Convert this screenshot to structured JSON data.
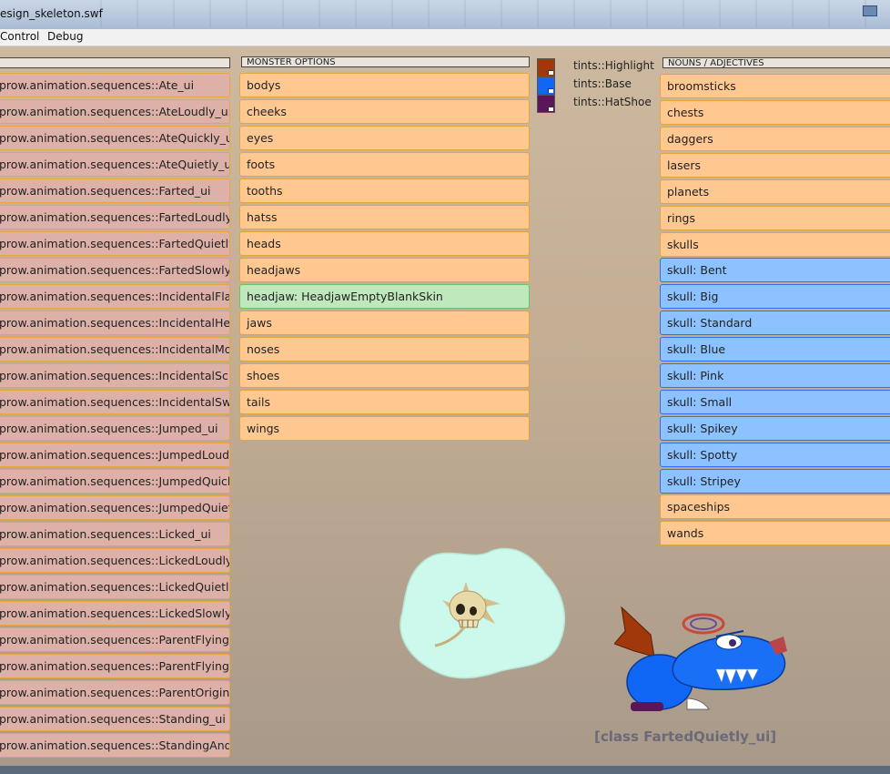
{
  "window": {
    "title": "esign_skeleton.swf"
  },
  "menu": [
    "Control",
    "Debug"
  ],
  "left_panel": {
    "header": "",
    "items": [
      "prow.animation.sequences::Ate_ui",
      "prow.animation.sequences::AteLoudly_ui",
      "prow.animation.sequences::AteQuickly_ui",
      "prow.animation.sequences::AteQuietly_ui",
      "prow.animation.sequences::Farted_ui",
      "prow.animation.sequences::FartedLoudly_u",
      "prow.animation.sequences::FartedQuietly",
      "prow.animation.sequences::FartedSlowly_u",
      "prow.animation.sequences::IncidentalFlap",
      "prow.animation.sequences::IncidentalHead",
      "prow.animation.sequences::IncidentalMout",
      "prow.animation.sequences::IncidentalScrat",
      "prow.animation.sequences::IncidentalSway",
      "prow.animation.sequences::Jumped_ui",
      "prow.animation.sequences::JumpedLoudly",
      "prow.animation.sequences::JumpedQuickly",
      "prow.animation.sequences::JumpedQuietly",
      "prow.animation.sequences::Licked_ui",
      "prow.animation.sequences::LickedLoudly_u",
      "prow.animation.sequences::LickedQuietly",
      "prow.animation.sequences::LickedSlowly_u",
      "prow.animation.sequences::ParentFlyingLo",
      "prow.animation.sequences::ParentFlyingOp",
      "prow.animation.sequences::ParentOriginal",
      "prow.animation.sequences::Standing_ui",
      "prow.animation.sequences::StandingAndFl"
    ]
  },
  "monster_options": {
    "header": "MONSTER OPTIONS",
    "items": [
      "bodys",
      "cheeks",
      "eyes",
      "foots",
      "tooths",
      "hatss",
      "heads",
      "headjaws",
      "headjaw: HeadjawEmptyBlankSkin",
      "jaws",
      "noses",
      "shoes",
      "tails",
      "wings"
    ],
    "selected": "headjaw: HeadjawEmptyBlankSkin"
  },
  "tints": [
    {
      "label": "tints::Highlight",
      "color": "#a0380a"
    },
    {
      "label": "tints::Base",
      "color": "#1167f5"
    },
    {
      "label": "tints::HatShoe",
      "color": "#5a1658"
    }
  ],
  "nouns": {
    "header": "NOUNS / ADJECTIVES",
    "items": [
      {
        "label": "broomsticks",
        "style": "orange"
      },
      {
        "label": "chests",
        "style": "orange"
      },
      {
        "label": "daggers",
        "style": "orange"
      },
      {
        "label": "lasers",
        "style": "orange"
      },
      {
        "label": "planets",
        "style": "orange"
      },
      {
        "label": "rings",
        "style": "orange"
      },
      {
        "label": "skulls",
        "style": "orange"
      },
      {
        "label": "skull: Bent",
        "style": "blue"
      },
      {
        "label": "skull: Big",
        "style": "blue"
      },
      {
        "label": "skull: Standard",
        "style": "blue"
      },
      {
        "label": "skull: Blue",
        "style": "blue"
      },
      {
        "label": "skull: Pink",
        "style": "blue"
      },
      {
        "label": "skull: Small",
        "style": "blue"
      },
      {
        "label": "skull: Spikey",
        "style": "blue"
      },
      {
        "label": "skull: Spotty",
        "style": "blue"
      },
      {
        "label": "skull: Stripey",
        "style": "blue"
      },
      {
        "label": "spaceships",
        "style": "orange"
      },
      {
        "label": "wands",
        "style": "orange"
      }
    ]
  },
  "preview": {
    "class_label": "[class FartedQuietly_ui]"
  },
  "colors": {
    "button": "#ffc891",
    "button_pink": "#ddb0a8",
    "button_green": "#bfe8bd",
    "button_blue": "#8cc2ff",
    "bubble": "#cdf8ec"
  }
}
